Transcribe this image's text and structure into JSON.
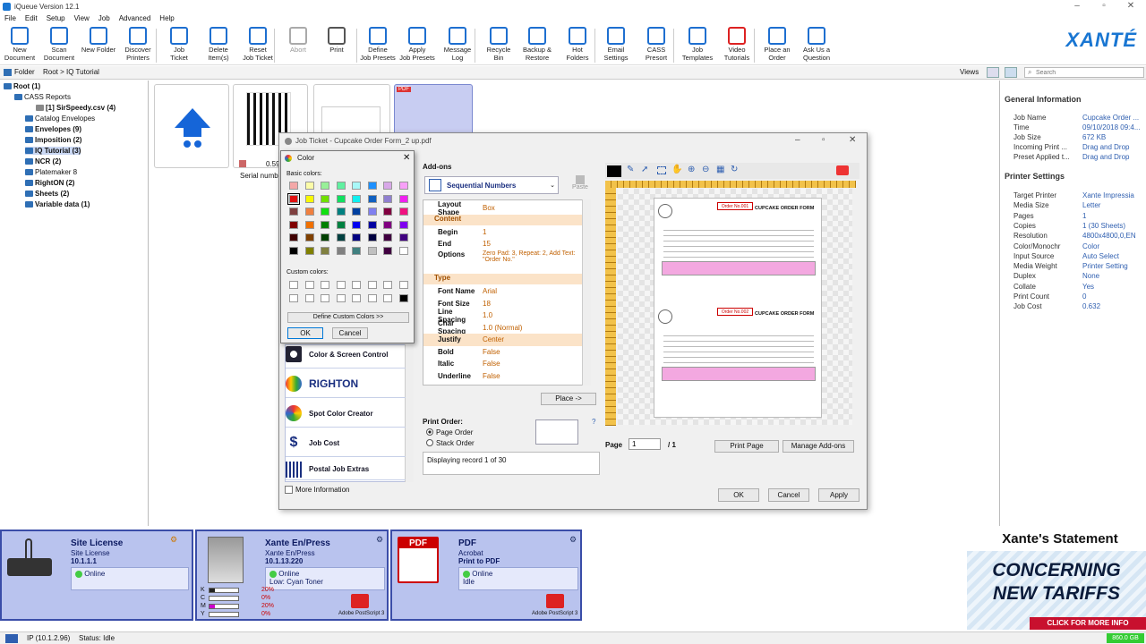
{
  "app": {
    "title": "iQueue Version 12.1",
    "logo": "XANTÉ"
  },
  "menu": [
    "File",
    "Edit",
    "Setup",
    "View",
    "Job",
    "Advanced",
    "Help"
  ],
  "toolbar": [
    {
      "l1": "New",
      "l2": "Document",
      "icon": "new-document-icon"
    },
    {
      "l1": "Scan",
      "l2": "Document",
      "icon": "scan-icon"
    },
    {
      "l1": "New Folder",
      "l2": "",
      "icon": "new-folder-icon"
    },
    {
      "l1": "Discover",
      "l2": "Printers",
      "icon": "discover-icon"
    },
    {
      "l1": "Job",
      "l2": "Ticket",
      "icon": "job-ticket-icon"
    },
    {
      "l1": "Delete",
      "l2": "Item(s)",
      "icon": "delete-icon"
    },
    {
      "l1": "Reset",
      "l2": "Job Ticket",
      "icon": "reset-icon"
    },
    {
      "l1": "Abort",
      "l2": "",
      "icon": "abort-icon"
    },
    {
      "l1": "Print",
      "l2": "",
      "icon": "print-icon"
    },
    {
      "l1": "Define",
      "l2": "Job Presets",
      "icon": "define-presets-icon"
    },
    {
      "l1": "Apply",
      "l2": "Job Presets",
      "icon": "apply-presets-icon"
    },
    {
      "l1": "Message",
      "l2": "Log",
      "icon": "message-log-icon"
    },
    {
      "l1": "Recycle",
      "l2": "Bin",
      "icon": "recycle-icon"
    },
    {
      "l1": "Backup &",
      "l2": "Restore",
      "icon": "backup-icon"
    },
    {
      "l1": "Hot",
      "l2": "Folders",
      "icon": "hot-folders-icon"
    },
    {
      "l1": "Email",
      "l2": "Settings",
      "icon": "email-icon"
    },
    {
      "l1": "CASS",
      "l2": "Presort",
      "icon": "cass-icon"
    },
    {
      "l1": "Job",
      "l2": "Templates",
      "icon": "job-templates-icon"
    },
    {
      "l1": "Video",
      "l2": "Tutorials",
      "icon": "video-icon"
    },
    {
      "l1": "Place an",
      "l2": "Order",
      "icon": "cart-icon"
    },
    {
      "l1": "Ask Us a",
      "l2": "Question",
      "icon": "question-icon"
    }
  ],
  "pathbar": {
    "label": "Folder",
    "path": "Root > IQ Tutorial",
    "views": "Views",
    "search_placeholder": "Search"
  },
  "tree": [
    {
      "label": "Root (1)",
      "bold": true
    },
    {
      "label": "CASS Reports",
      "bold": false
    },
    {
      "label": "[1] SirSpeedy.csv  (4)",
      "bold": true
    },
    {
      "label": "Catalog Envelopes",
      "bold": false
    },
    {
      "label": "Envelopes (9)",
      "bold": true
    },
    {
      "label": "Imposition (2)",
      "bold": true
    },
    {
      "label": "IQ Tutorial  (3)",
      "bold": true
    },
    {
      "label": "NCR (2)",
      "bold": true
    },
    {
      "label": "Platemaker 8",
      "bold": false
    },
    {
      "label": "RightON (2)",
      "bold": true
    },
    {
      "label": "Sheets (2)",
      "bold": true
    },
    {
      "label": "Variable data  (1)",
      "bold": true
    }
  ],
  "thumbs": {
    "caption1": "0.59",
    "caption2": "Serial numb",
    "pdf_badge": "PDF"
  },
  "info": {
    "general_title": "General Information",
    "general": [
      [
        "Job Name",
        "Cupcake Order ..."
      ],
      [
        "Time",
        "09/10/2018 09:4..."
      ],
      [
        "Job Size",
        "672 KB"
      ],
      [
        "Incoming Print ...",
        "Drag and Drop"
      ],
      [
        "Preset Applied t...",
        "Drag and Drop"
      ]
    ],
    "printer_title": "Printer Settings",
    "printer": [
      [
        "Target Printer",
        "Xante Impressia"
      ],
      [
        "Media Size",
        "Letter"
      ],
      [
        "Pages",
        "1"
      ],
      [
        "Copies",
        "1 (30 Sheets)"
      ],
      [
        "Resolution",
        "4800x4800,0,EN"
      ],
      [
        "Color/Monochr",
        "Color"
      ],
      [
        "Input Source",
        "Auto Select"
      ],
      [
        "Media Weight",
        "Printer Setting"
      ],
      [
        "Duplex",
        "None"
      ],
      [
        "Collate",
        "Yes"
      ],
      [
        "Print Count",
        "0"
      ],
      [
        "Job Cost",
        "0.632"
      ]
    ]
  },
  "jobticket": {
    "title": "Job Ticket - Cupcake Order Form_2 up.pdf",
    "addons_label": "Add-ons",
    "addon_select": "Sequential Numbers",
    "paste": "Paste",
    "props": [
      {
        "k": "Layout Shape",
        "v": "Box"
      },
      {
        "section": "Content"
      },
      {
        "k": "Begin",
        "v": "1"
      },
      {
        "k": "End",
        "v": "15"
      },
      {
        "k": "Options",
        "v": "Zero Pad: 3, Repeat: 2, Add Text: \"Order No.\""
      },
      {
        "section": "Type"
      },
      {
        "k": "Font Name",
        "v": "Arial"
      },
      {
        "k": "Font Size",
        "v": "18"
      },
      {
        "k": "Line Spacing",
        "v": "1.0"
      },
      {
        "k": "Char Spacing",
        "v": "1.0 (Normal)"
      },
      {
        "k": "Justify",
        "v": "Center"
      },
      {
        "k": "Bold",
        "v": "False"
      },
      {
        "k": "Italic",
        "v": "False"
      },
      {
        "k": "Underline",
        "v": "False"
      }
    ],
    "place": "Place ->",
    "print_order": "Print Order:",
    "page_order": "Page Order",
    "stack_order": "Stack Order",
    "record": "Displaying record 1 of 30",
    "page_label": "Page",
    "page_value": "1",
    "page_total": "/ 1",
    "print_page": "Print Page",
    "manage_addons": "Manage Add-ons",
    "ok": "OK",
    "cancel": "Cancel",
    "apply": "Apply",
    "more_info": "More Information",
    "plugins": [
      "Color & Screen Control",
      "RIGHTON",
      "Spot Color Creator",
      "Job Cost",
      "Postal Job Extras"
    ],
    "form_title": "CUPCAKE ORDER FORM",
    "order_no": "Order No.001",
    "order_no2": "Order No.002"
  },
  "color": {
    "title": "Color",
    "basic": "Basic colors:",
    "custom": "Custom colors:",
    "define": "Define Custom Colors >>",
    "ok": "OK",
    "cancel": "Cancel",
    "swatches": [
      [
        "#f4a8a8",
        "#fcfca8",
        "#98f098",
        "#60f0a0",
        "#a8f8f8",
        "#1e90ff",
        "#d8a8e8",
        "#f8a0f8"
      ],
      [
        "#e01010",
        "#f8f800",
        "#70e000",
        "#10e060",
        "#10f0f0",
        "#1060c0",
        "#9080d0",
        "#f020f0"
      ],
      [
        "#804040",
        "#f08040",
        "#10e010",
        "#008080",
        "#0040a0",
        "#8080f0",
        "#800040",
        "#f01080"
      ],
      [
        "#800000",
        "#f07000",
        "#008000",
        "#008040",
        "#0000f0",
        "#0000a0",
        "#800080",
        "#8000f0"
      ],
      [
        "#400000",
        "#804000",
        "#004000",
        "#004040",
        "#000080",
        "#000040",
        "#400040",
        "#400080"
      ],
      [
        "#000000",
        "#808000",
        "#808040",
        "#808080",
        "#408080",
        "#c0c0c0",
        "#400040",
        "#ffffff"
      ]
    ]
  },
  "printers": [
    {
      "name": "Site License",
      "sub1": "Site License",
      "sub2": "10.1.1.1",
      "status": "Online",
      "status2": ""
    },
    {
      "name": "Xante En/Press",
      "sub1": "Xante En/Press",
      "sub2": "10.1.13.220",
      "status": "Online",
      "status2": "Low: Cyan Toner",
      "ps": "Adobe PostScript 3"
    },
    {
      "name": "PDF",
      "sub1": "Acrobat",
      "sub2": "Print to PDF",
      "status": "Online",
      "status2": "Idle",
      "ps": "Adobe PostScript 3"
    }
  ],
  "toner": [
    {
      "c": "K",
      "pct": "20%"
    },
    {
      "c": "C",
      "pct": "0%"
    },
    {
      "c": "M",
      "pct": "20%"
    },
    {
      "c": "Y",
      "pct": "0%"
    }
  ],
  "ad": {
    "title": "Xante's Statement",
    "line1": "CONCERNING",
    "line2": "NEW TARIFFS",
    "cta": "CLICK FOR MORE INFO"
  },
  "statusbar": {
    "ip": "IP (10.1.2.96)",
    "status": "Status: Idle",
    "disk": "860.0 GB"
  }
}
